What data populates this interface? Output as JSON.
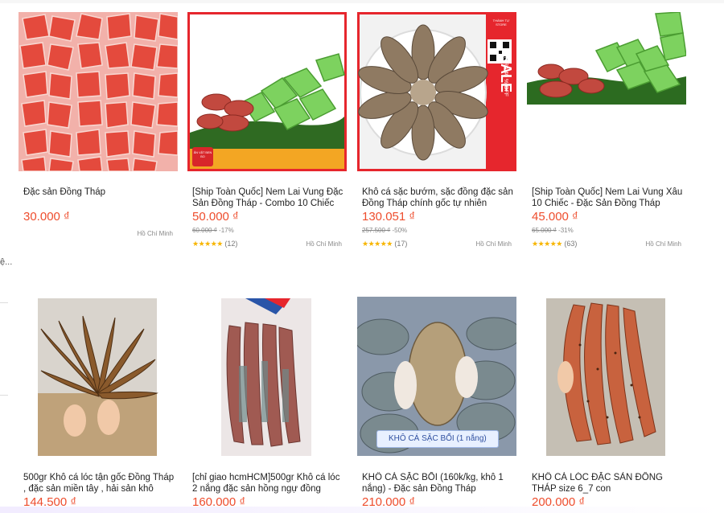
{
  "partial_side_text": "ệ...",
  "products": [
    {
      "title": "Đặc sản Đồng Tháp",
      "price": "30.000 ₫",
      "old_price": "",
      "discount": "",
      "reviews": "",
      "location": "Hồ Chí Minh",
      "image": "red-candy-packs-image"
    },
    {
      "title": "[Ship Toàn Quốc] Nem Lai Vung Đặc Sản Đồng Tháp - Combo 10 Chiếc",
      "price": "50.000 ₫",
      "old_price": "60.000 ₫",
      "discount": "-17%",
      "reviews": "(12)",
      "location": "Hồ Chí Minh",
      "image": "nem-lai-vung-image",
      "stamp": "ĂN VẶT BEN BO"
    },
    {
      "title": "Khô cá sặc bướm, sặc đồng đặc sản Đồng Tháp chính gốc tự nhiên ,Mim...",
      "price": "130.051 ₫",
      "old_price": "257.500 ₫",
      "discount": "-50%",
      "reviews": "(17)",
      "location": "Hồ Chí Minh",
      "image": "dried-fish-plate-image",
      "sale_label": "SALE",
      "sale_sub": "EXTRA 40 % OFF",
      "store_label": "THÀNH TỰ STORE"
    },
    {
      "title": "[Ship Toàn Quốc] Nem Lai Vung Xâu 10 Chiếc - Đặc Sản Đồng Tháp",
      "price": "45.000 ₫",
      "old_price": "65.000 ₫",
      "discount": "-31%",
      "reviews": "(63)",
      "location": "Hồ Chí Minh",
      "image": "nem-lai-vung-xau-image"
    },
    {
      "title": "500gr Khô cá lóc tận gốc Đồng Tháp , đặc sản miền tây , hải sản khô thơm...",
      "price": "144.500 ₫",
      "image": "dried-snakehead-fish-image"
    },
    {
      "title": "[chỉ giao hcmHCM]500gr Khô cá lóc 2 nắng đặc sản hồng ngự đồng tháp...",
      "price": "160.000 ₫",
      "image": "dried-fish-bag-image"
    },
    {
      "title": "KHÔ CÁ SẶC BỔI (160k/kg, khô 1 nắng) - Đặc sản Đồng Tháp",
      "price": "210.000 ₫",
      "image": "kho-ca-sac-boi-image",
      "caption": "KHÔ CÁ SẶC BỔI (1 nắng)"
    },
    {
      "title": "KHÔ CÁ LÓC ĐẶC SẢN ĐỒNG THÁP size 6_7 con",
      "price": "200.000 ₫",
      "image": "spiced-dried-fish-image"
    }
  ],
  "colors": {
    "price": "#ee4d2d",
    "star": "#f7b500",
    "sale_red": "#e8262a"
  }
}
